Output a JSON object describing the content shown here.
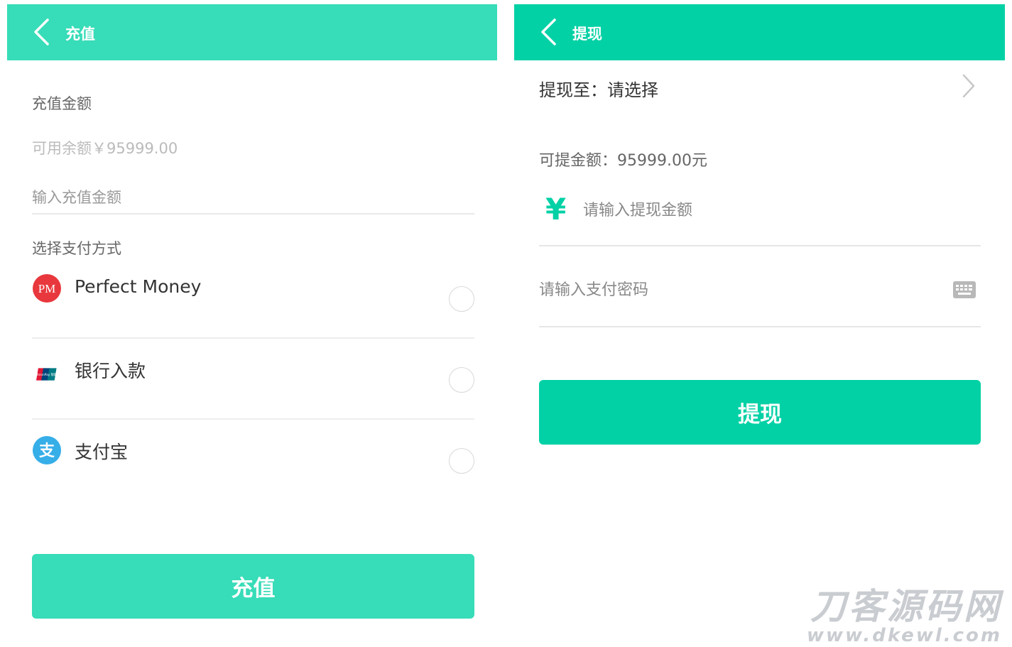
{
  "recharge": {
    "title": "充值",
    "amount_label": "充值金额",
    "balance_text": "可用余额￥95999.00",
    "amount_placeholder": "输入充值金额",
    "method_label": "选择支付方式",
    "methods": [
      {
        "label": "Perfect Money",
        "icon": "perfect-money-icon",
        "icon_text": "PM"
      },
      {
        "label": "银行入款",
        "icon": "unionpay-icon",
        "icon_text": "UnionPay 银联"
      },
      {
        "label": "支付宝",
        "icon": "alipay-icon",
        "icon_text": "支"
      }
    ],
    "submit_label": "充值",
    "header_color": "#37dcb8"
  },
  "withdraw": {
    "title": "提现",
    "target_text": "提现至：请选择",
    "available_text": "可提金额：95999.00元",
    "currency_symbol": "¥",
    "amount_placeholder": "请输入提现金额",
    "password_placeholder": "请输入支付密码",
    "submit_label": "提现",
    "header_color": "#02d1a5"
  },
  "watermark": {
    "name": "刀客源码网",
    "url": "www.dkewl.com"
  }
}
